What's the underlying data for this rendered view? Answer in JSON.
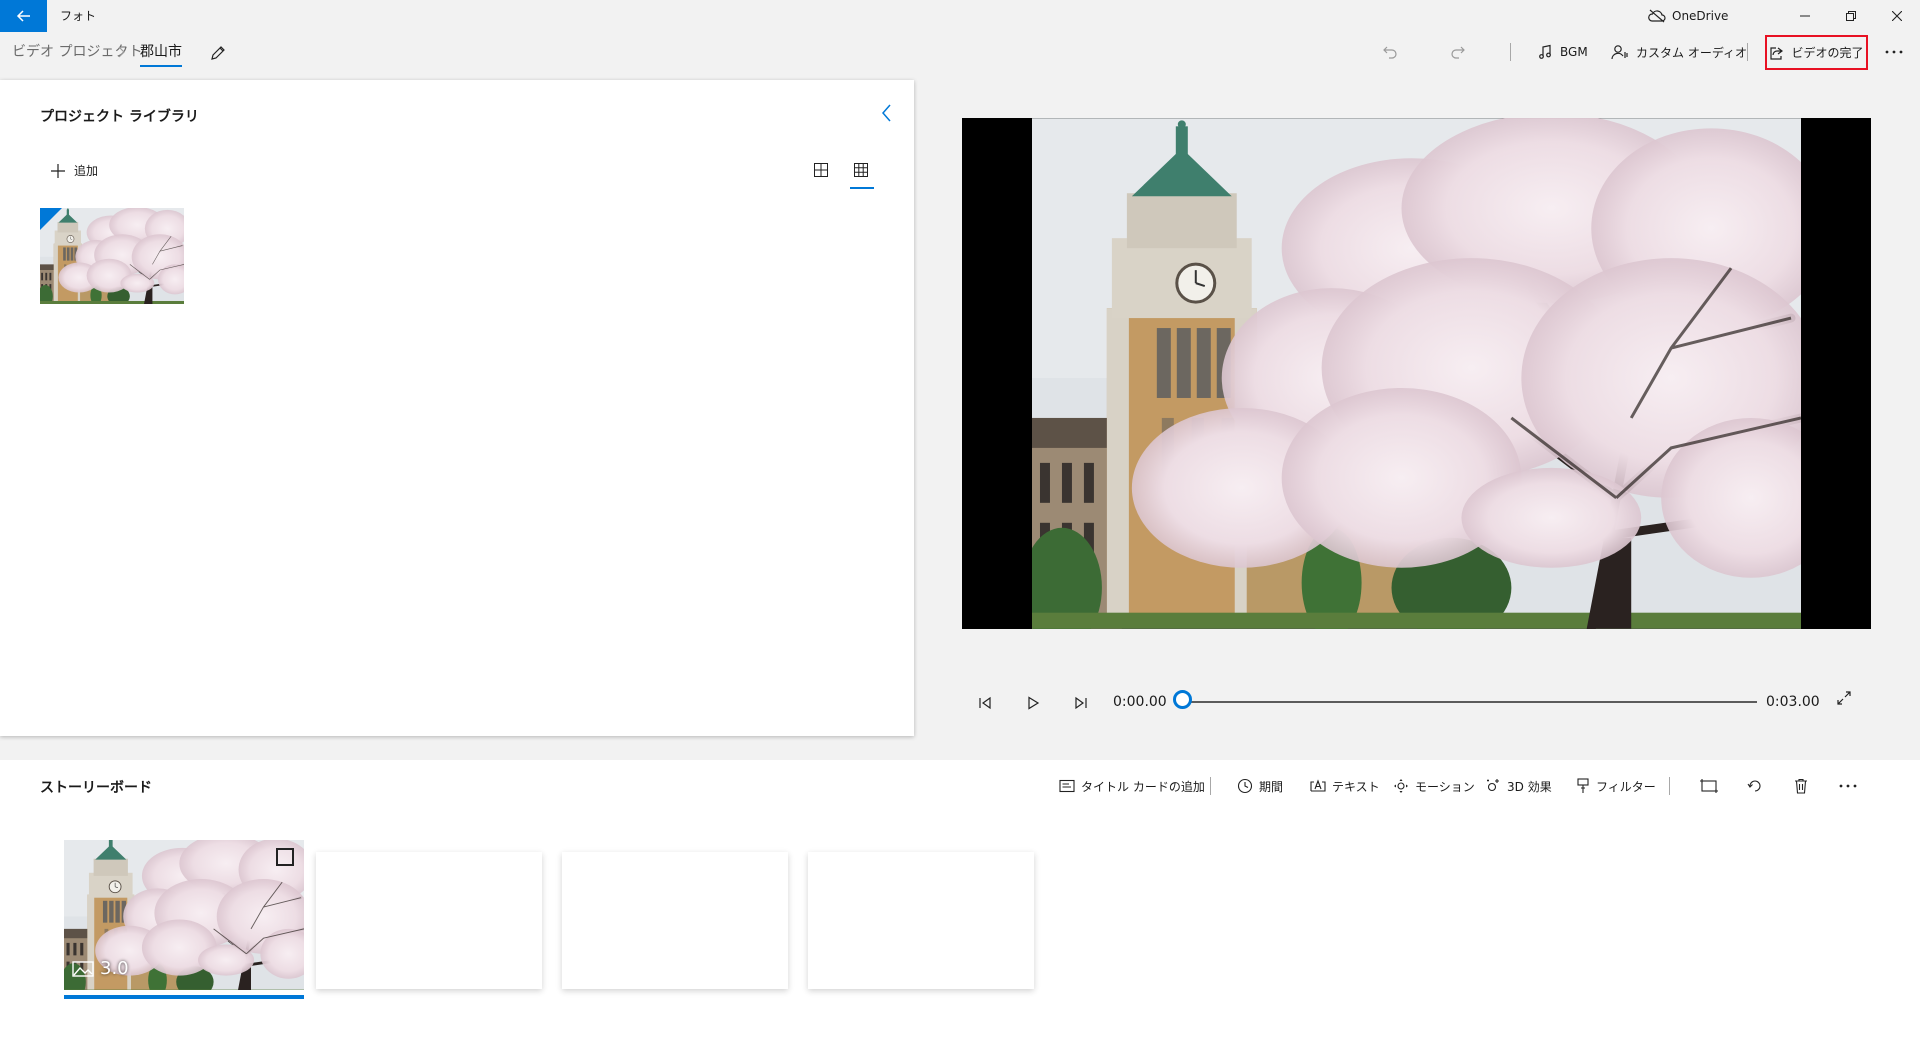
{
  "app": {
    "title": "フォト",
    "onedrive_label": "OneDrive"
  },
  "breadcrumb": {
    "root": "ビデオ プロジェクト",
    "current": "郡山市"
  },
  "toolbar": {
    "bgm_label": "BGM",
    "custom_audio_label": "カスタム オーディオ",
    "finish_label": "ビデオの完了"
  },
  "library": {
    "title": "プロジェクト ライブラリ",
    "add_label": "追加"
  },
  "playback": {
    "current_time": "0:00.00",
    "total_time": "0:03.00",
    "progress": 0
  },
  "storyboard": {
    "title": "ストーリーボード",
    "add_title_card_label": "タイトル カードの追加",
    "duration_label": "期間",
    "text_label": "テキスト",
    "motion_label": "モーション",
    "effects_3d_label": "3D 効果",
    "filters_label": "フィルター",
    "clips": [
      {
        "duration": "3.0",
        "selected": true
      }
    ],
    "empty_slots": 3
  },
  "colors": {
    "accent": "#0078d7",
    "highlight": "#e81123"
  }
}
